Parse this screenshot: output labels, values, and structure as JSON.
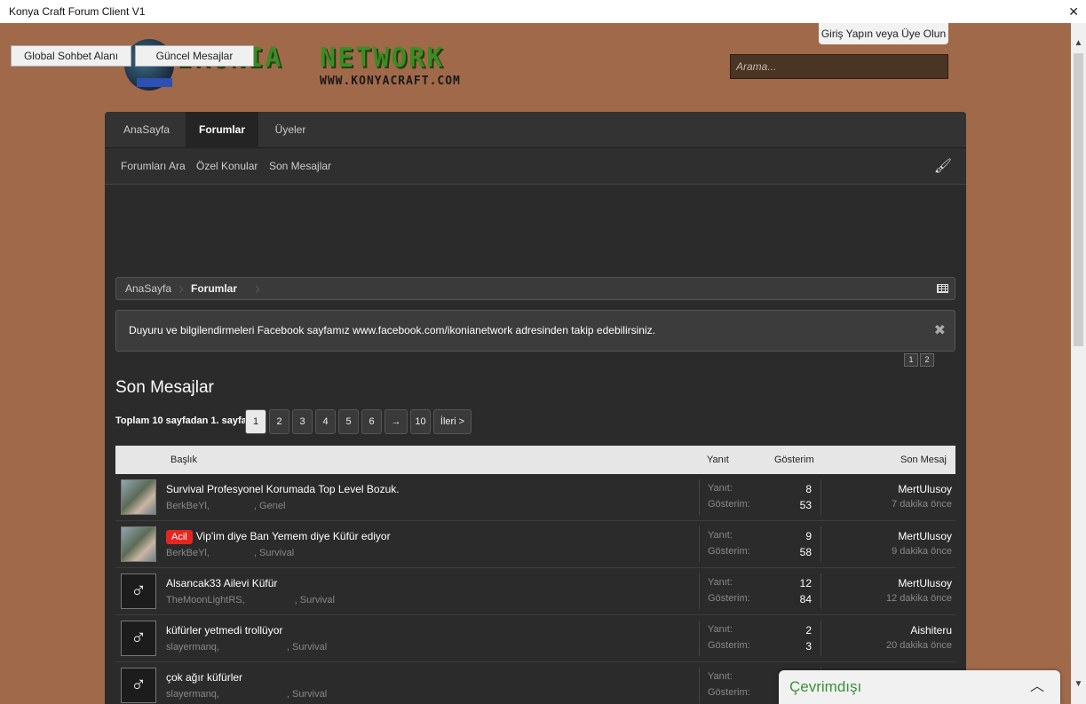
{
  "window": {
    "title": "Konya Craft Forum Client V1",
    "close_glyph": "✕"
  },
  "header": {
    "global_chat_label": "Global Sohbet Alanı",
    "recent_posts_label": "Güncel Mesajlar",
    "login_label": "Giriş Yapın veya Üye Olun",
    "search_placeholder": "Arama...",
    "logo": {
      "word1": "IKONIA",
      "word2": "NETWORK",
      "url": "WWW.KONYACRAFT.COM"
    }
  },
  "nav": {
    "tabs": [
      {
        "label": "AnaSayfa",
        "active": false
      },
      {
        "label": "Forumlar",
        "active": true
      },
      {
        "label": "Üyeler",
        "active": false
      }
    ],
    "subnav": [
      "Forumları Ara",
      "Özel Konular",
      "Son Mesajlar"
    ]
  },
  "breadcrumb": {
    "items": [
      "AnaSayfa",
      "Forumlar"
    ]
  },
  "notice": {
    "text": "Duyuru ve bilgilendirmeleri Facebook sayfamız www.facebook.com/ikonianetwork adresinden takip edebilirsiniz.",
    "pages": [
      "1",
      "2"
    ]
  },
  "section": {
    "title": "Son Mesajlar"
  },
  "pagination": {
    "label": "Toplam 10 sayfadan 1. sayfa",
    "pages": [
      "1",
      "2",
      "3",
      "4",
      "5",
      "6",
      "→",
      "10",
      "İleri >"
    ],
    "current": "1"
  },
  "table": {
    "headers": {
      "title": "Başlık",
      "replies": "Yanıt",
      "views": "Gösterim",
      "last": "Son Mesaj"
    },
    "reply_label": "Yanıt:",
    "view_label": "Gösterim:",
    "rows": [
      {
        "title": "Survival Profesyonel Korumada Top Level Bozuk.",
        "badge": "",
        "author": "BerkBeYl,",
        "forum": ", Genel",
        "replies": "8",
        "views": "53",
        "last_user": "MertUlusoy",
        "last_time": "7 dakika önce",
        "avatar": "photo"
      },
      {
        "title": "Vip'im diye Ban Yemem diye Küfür ediyor",
        "badge": "Acil",
        "author": "BerkBeYl,",
        "forum": ", Survival",
        "replies": "9",
        "views": "58",
        "last_user": "MertUlusoy",
        "last_time": "9 dakika önce",
        "avatar": "photo"
      },
      {
        "title": "Alsancak33 Ailevi Küfür",
        "badge": "",
        "author": "TheMoonLightRS,",
        "forum": ", Survival",
        "replies": "12",
        "views": "84",
        "last_user": "MertUlusoy",
        "last_time": "12 dakika önce",
        "avatar": "male"
      },
      {
        "title": "küfürler yetmedi trollüyor",
        "badge": "",
        "author": "slayermanq,",
        "forum": ", Survival",
        "replies": "2",
        "views": "3",
        "last_user": "Aishiteru",
        "last_time": "20 dakika önce",
        "avatar": "male"
      },
      {
        "title": "çok ağır küfürler",
        "badge": "",
        "author": "slayermanq,",
        "forum": ", Survival",
        "replies": "",
        "views": "",
        "last_user": "",
        "last_time": "",
        "avatar": "male"
      }
    ]
  },
  "chat": {
    "status_label": "Çevrimdışı",
    "status_color": "#3c8f3c"
  },
  "colors": {
    "background": "#a0694a",
    "panel": "#2b2b2b",
    "badge": "#e52521"
  }
}
